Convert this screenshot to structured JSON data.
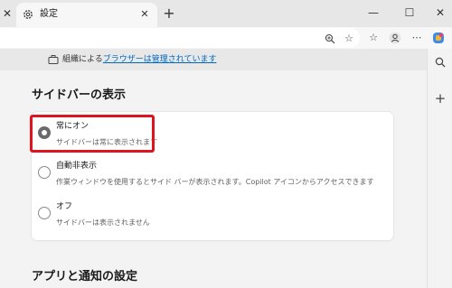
{
  "tab": {
    "title": "設定",
    "icon": "gear-icon"
  },
  "managed_notice": {
    "prefix": "組織による",
    "link": "ブラウザーは管理されています"
  },
  "section_sidebar": {
    "title": "サイドバーの表示"
  },
  "options": [
    {
      "label": "常にオン",
      "description": "サイドバーは常に表示されます",
      "selected": true
    },
    {
      "label": "自動非表示",
      "description": "作業ウィンドウを使用するとサイド バーが表示されます。Copilot アイコンからアクセスできます",
      "selected": false
    },
    {
      "label": "オフ",
      "description": "サイドバーは表示されません",
      "selected": false
    }
  ],
  "section_apps": {
    "title": "アプリと通知の設定"
  },
  "colors": {
    "highlight": "#e0141e",
    "link": "#0067c0",
    "radio_checked": "#6a6a6a"
  }
}
